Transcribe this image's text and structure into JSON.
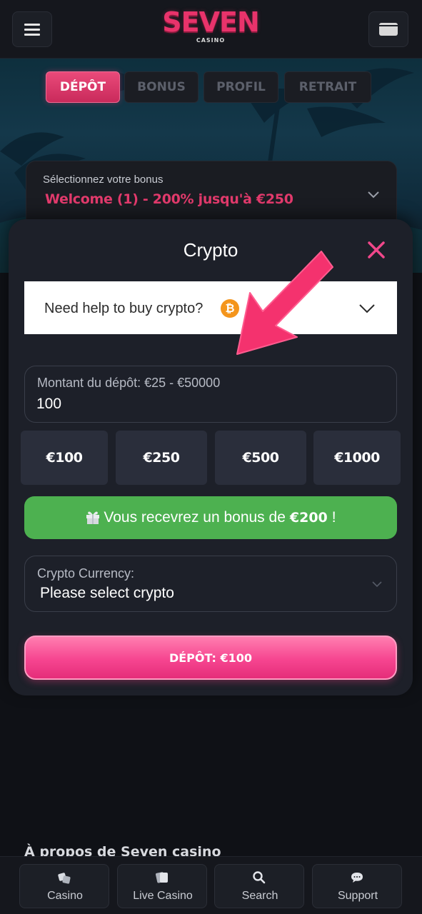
{
  "header": {
    "logo_main": "SEVEN",
    "logo_sub": "CASINO",
    "menu_icon": "hamburger-icon",
    "wallet_icon": "wallet-icon"
  },
  "tabs": [
    {
      "label": "DÉPÔT",
      "active": true
    },
    {
      "label": "BONUS",
      "active": false
    },
    {
      "label": "PROFIL",
      "active": false
    },
    {
      "label": "RETRAIT",
      "active": false
    }
  ],
  "bonus_selector": {
    "caption": "Sélectionnez votre bonus",
    "value": "Welcome (1) - 200% jusqu'à €250"
  },
  "modal": {
    "title": "Crypto",
    "help_text": "Need help to buy crypto?",
    "amount": {
      "label": "Montant du dépôt: €25 - €50000",
      "value": "100"
    },
    "presets": [
      "€100",
      "€250",
      "€500",
      "€1000"
    ],
    "bonus_banner": {
      "prefix": "Vous recevrez un bonus de",
      "amount": "€200",
      "suffix": "!"
    },
    "crypto_select": {
      "label": "Crypto Currency:",
      "value": "Please select crypto"
    },
    "deposit_button": "DÉPÔT: €100"
  },
  "about_heading": "À propos de Seven casino",
  "bottom_nav": [
    {
      "label": "Casino",
      "icon": "dice-icon"
    },
    {
      "label": "Live Casino",
      "icon": "cards-icon"
    },
    {
      "label": "Search",
      "icon": "search-icon"
    },
    {
      "label": "Support",
      "icon": "chat-icon"
    }
  ],
  "colors": {
    "accent_pink": "#e23a6c",
    "success_green": "#4db150",
    "bitcoin_orange": "#f4951c"
  }
}
